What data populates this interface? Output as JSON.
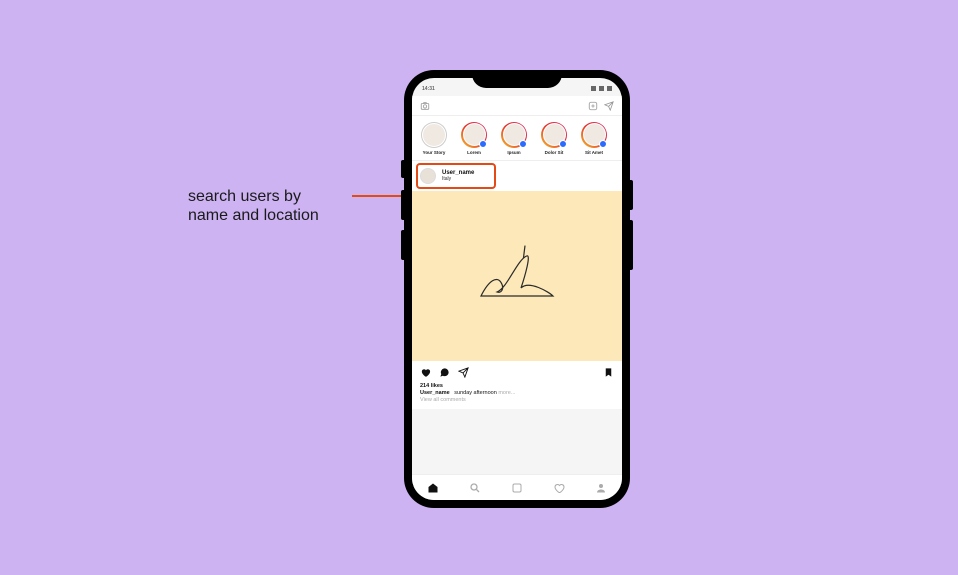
{
  "callout": "search users by\nname and location",
  "status": {
    "time": "14:31"
  },
  "stories": [
    {
      "label": "Your Story",
      "me": true
    },
    {
      "label": "Lorem"
    },
    {
      "label": "Ipsum"
    },
    {
      "label": "Dolor Sit"
    },
    {
      "label": "Sit Amet"
    }
  ],
  "post": {
    "username": "User_name",
    "location": "Italy",
    "likes": "214 likes",
    "caption_user": "User_name",
    "caption_text": "sunday afternoon",
    "caption_more": "more...",
    "view_comments": "View all comments"
  }
}
